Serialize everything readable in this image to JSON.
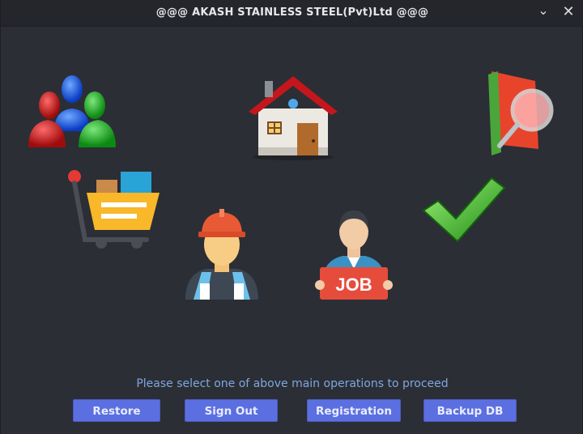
{
  "window": {
    "title": "@@@ AKASH STAINLESS STEEL(Pvt)Ltd @@@",
    "minimize_glyph": "⌄",
    "close_glyph": "✕"
  },
  "icons": {
    "users": "users-group-icon",
    "home": "house-icon",
    "search": "search-document-icon",
    "cart": "shopping-cart-icon",
    "worker": "worker-icon",
    "job": "job-seeker-icon",
    "check": "checkmark-icon"
  },
  "job_sign_text": "JOB",
  "prompt": "Please select one of above main operations to proceed",
  "buttons": {
    "restore": "Restore",
    "sign_out": "Sign Out",
    "registration": "Registration",
    "backup": "Backup DB"
  },
  "colors": {
    "background": "#2b2e35",
    "button": "#5b6fe0",
    "prompt": "#7fa7de"
  }
}
